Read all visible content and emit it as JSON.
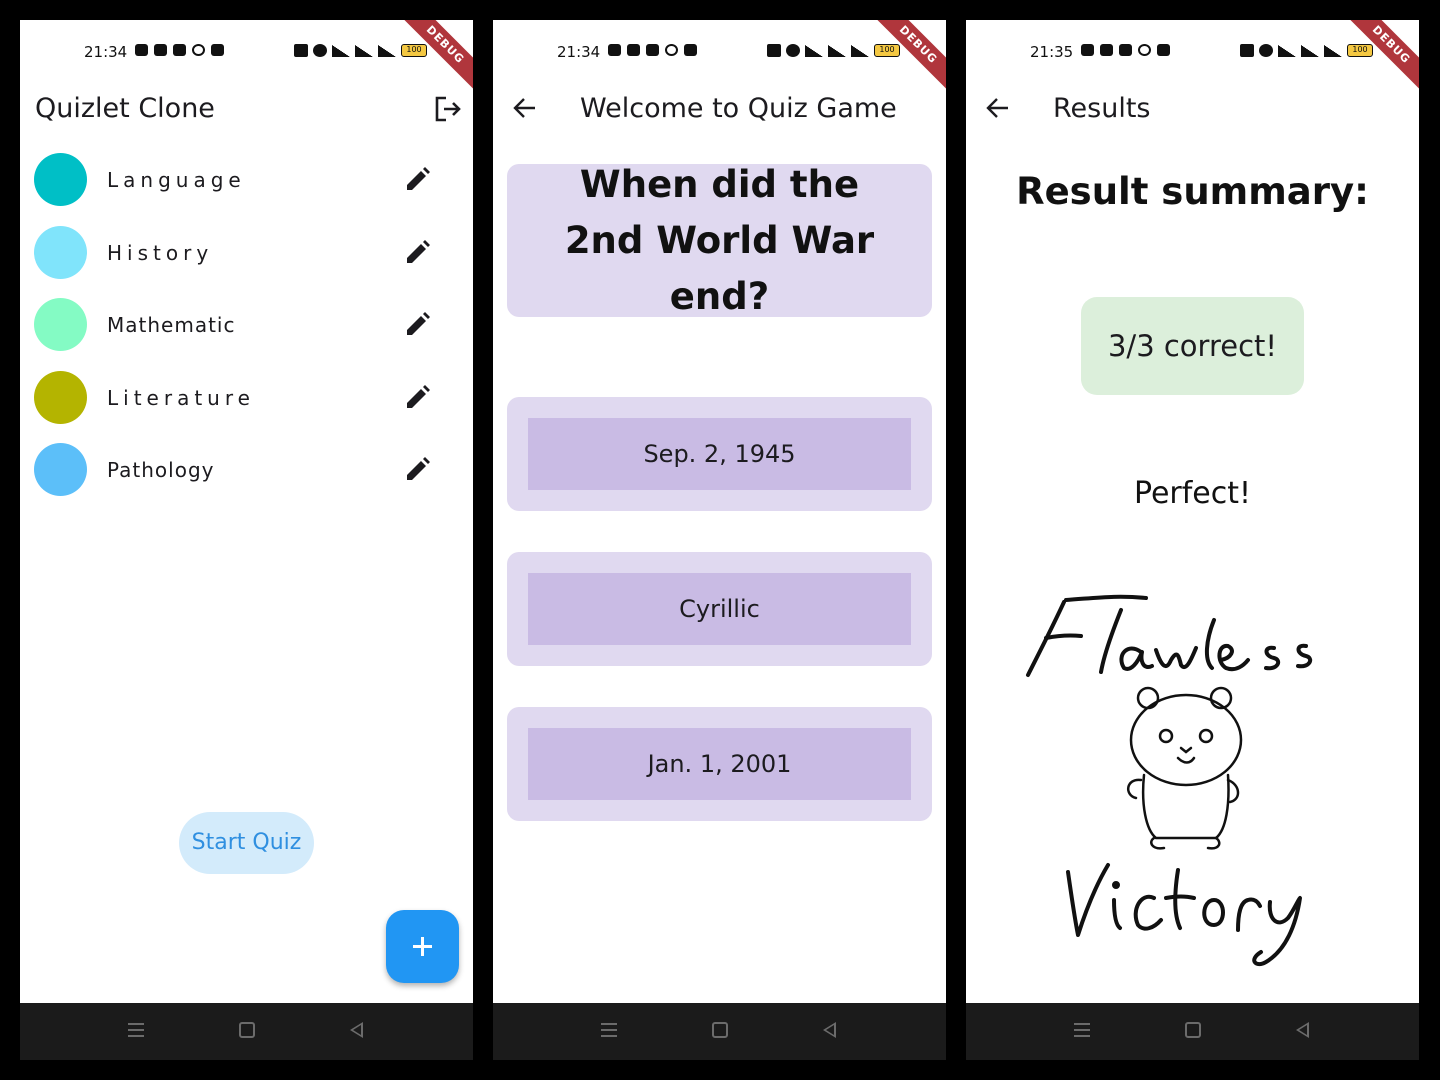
{
  "screens": [
    {
      "status": {
        "time": "21:34",
        "battery": "100"
      },
      "debug_label": "DEBUG",
      "appbar": {
        "title": "Quizlet Clone"
      },
      "topics": [
        {
          "label": "Language",
          "color": "#00bfc6"
        },
        {
          "label": "History",
          "color": "#80e4fb"
        },
        {
          "label": "Mathematic",
          "color": "#84fbc4"
        },
        {
          "label": "Literature",
          "color": "#b4b400"
        },
        {
          "label": "Pathology",
          "color": "#5cbff9"
        }
      ],
      "start_button": "Start Quiz",
      "fab_icon": "plus-icon"
    },
    {
      "status": {
        "time": "21:34",
        "battery": "100"
      },
      "debug_label": "DEBUG",
      "appbar": {
        "title": "Welcome to Quiz Game"
      },
      "question": "When did the 2nd World War end?",
      "answers": [
        "Sep. 2, 1945",
        "Cyrillic",
        "Jan. 1, 2001"
      ]
    },
    {
      "status": {
        "time": "21:35",
        "battery": "100"
      },
      "debug_label": "DEBUG",
      "appbar": {
        "title": "Results"
      },
      "summary_title": "Result summary:",
      "score": "3/3 correct!",
      "verdict": "Perfect!",
      "sketch_text": {
        "top": "Flawless",
        "bottom": "Victory"
      }
    }
  ],
  "colors": {
    "accent": "#2196f3",
    "card": "#e0d9f0",
    "answer": "#c9bbe4",
    "score_bg": "#dcefdb",
    "ribbon": "#b0363c"
  }
}
